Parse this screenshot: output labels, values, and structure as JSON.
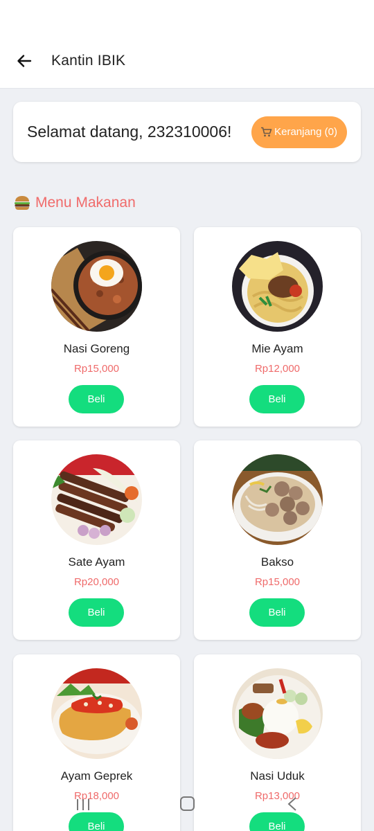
{
  "app_bar": {
    "title": "Kantin IBIK"
  },
  "welcome": {
    "text": "Selamat datang, 232310006!",
    "cart_label": "Keranjang (0)"
  },
  "section": {
    "title": "Menu Makanan"
  },
  "menu": [
    {
      "name": "Nasi Goreng",
      "price": "Rp15,000",
      "button": "Beli"
    },
    {
      "name": "Mie Ayam",
      "price": "Rp12,000",
      "button": "Beli"
    },
    {
      "name": "Sate Ayam",
      "price": "Rp20,000",
      "button": "Beli"
    },
    {
      "name": "Bakso",
      "price": "Rp15,000",
      "button": "Beli"
    },
    {
      "name": "Ayam Geprek",
      "price": "Rp18,000",
      "button": "Beli"
    },
    {
      "name": "Nasi Uduk",
      "price": "Rp13,000",
      "button": "Beli"
    }
  ],
  "colors": {
    "accent": "#f06b6b",
    "cart": "#ffa54a",
    "buy": "#14dd7e"
  },
  "icons": {
    "back": "arrow-left-icon",
    "cart": "cart-icon",
    "section": "burger-icon"
  }
}
